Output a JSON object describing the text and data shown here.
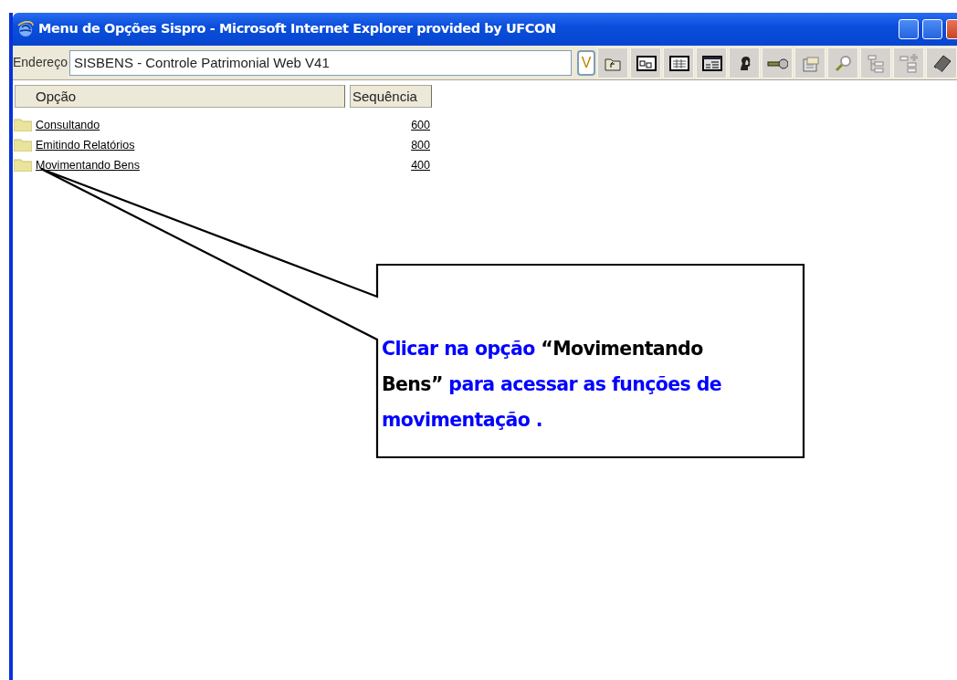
{
  "window": {
    "title": "Menu de Opções Sispro - Microsoft Internet Explorer provided by UFCON"
  },
  "address_bar": {
    "label": "Endereço",
    "value": "SISBENS - Controle Patrimonial Web V41"
  },
  "toolbar": {
    "first_button": "V"
  },
  "table": {
    "columns": [
      "Opção",
      "Sequência"
    ],
    "rows": [
      {
        "option": "Consultando",
        "sequence": "600"
      },
      {
        "option": "Emitindo Relatórios",
        "sequence": "800"
      },
      {
        "option": "Movimentando Bens",
        "sequence": "400"
      }
    ]
  },
  "callout": {
    "segments": [
      {
        "text": "Clicar na opção ",
        "color": "#0000ff"
      },
      {
        "text": "“Movimentando Bens”",
        "color": "#000000"
      },
      {
        "text": " para acessar as funções de movimentação .",
        "color": "#0000ff"
      }
    ]
  }
}
